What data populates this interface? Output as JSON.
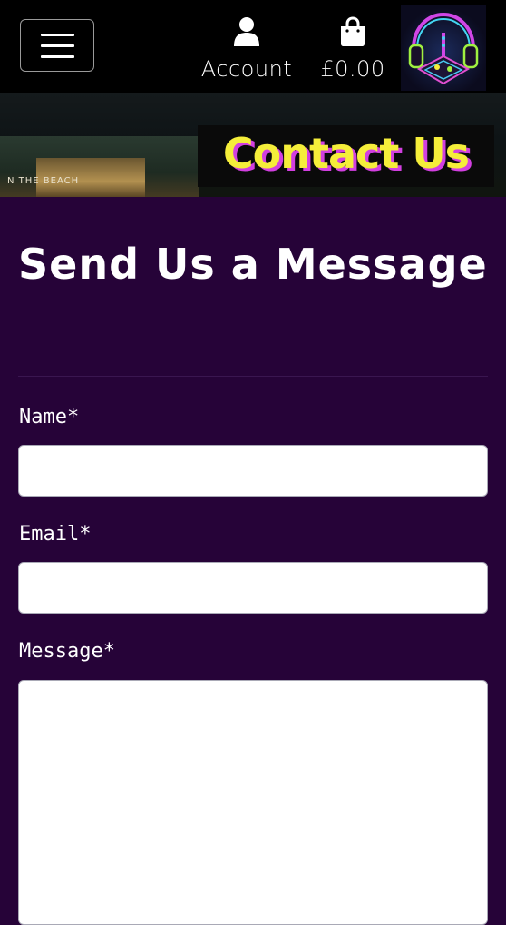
{
  "header": {
    "account_label": "Account",
    "cart_total": "£0.00",
    "icons": {
      "menu": "hamburger-menu-icon",
      "account": "user-icon",
      "cart": "shopping-bag-icon",
      "logo": "headphones-dj-logo"
    }
  },
  "hero": {
    "title": "Contact Us",
    "background_sign_text": "N THE BEACH",
    "title_color": "#f5ee3a",
    "title_shadow_color": "#d23fe0"
  },
  "form": {
    "heading": "Send Us a Message",
    "fields": [
      {
        "label": "Name*",
        "value": ""
      },
      {
        "label": "Email*",
        "value": ""
      },
      {
        "label": "Message*",
        "value": ""
      }
    ]
  },
  "colors": {
    "page_background": "#260338",
    "header_background": "#000000",
    "text": "#ffffff"
  }
}
